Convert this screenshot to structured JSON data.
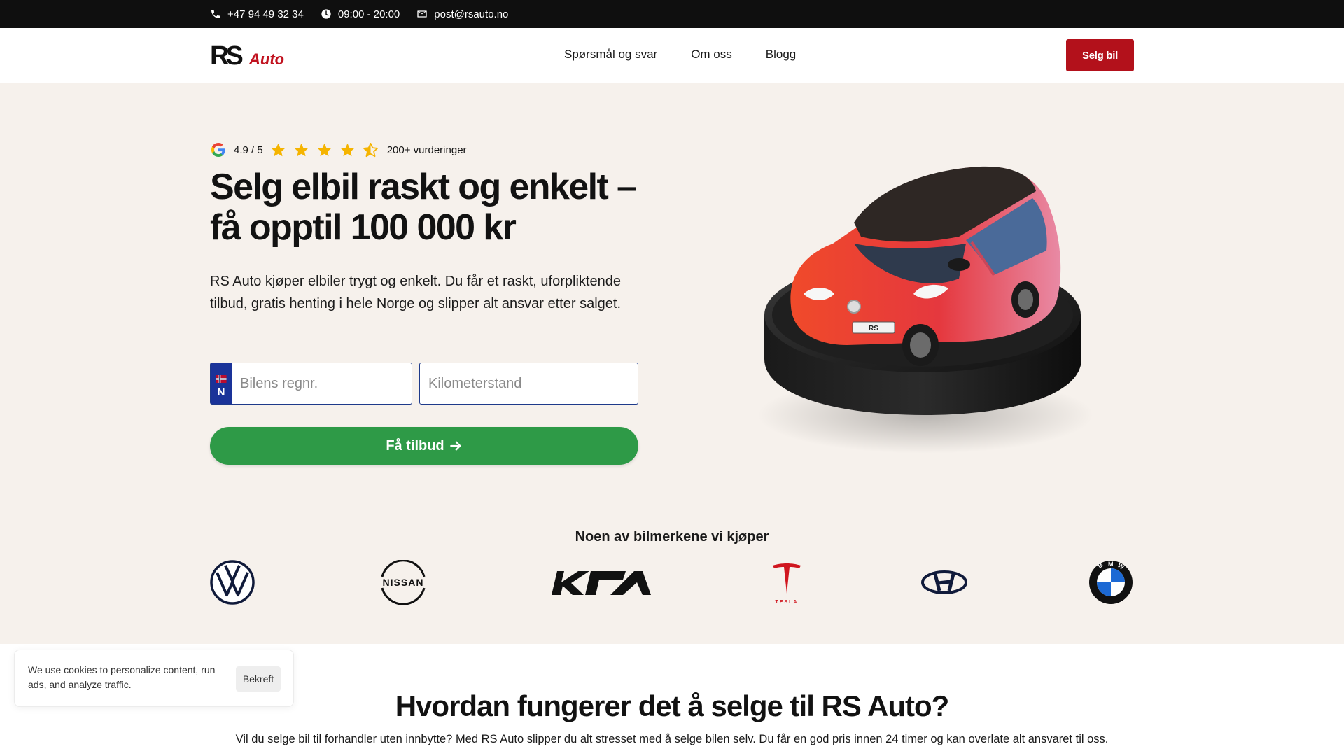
{
  "topbar": {
    "phone": "+47 94 49 32 34",
    "hours": "09:00 - 20:00",
    "email": "post@rsauto.no"
  },
  "header": {
    "logo_text": "RS Auto",
    "nav": [
      "Spørsmål og svar",
      "Om oss",
      "Blogg"
    ],
    "cta_label": "Selg bil"
  },
  "colors": {
    "brand_red": "#b3111b",
    "cta_green": "#2e9a47",
    "hero_bg": "#f6f1ec",
    "plate_blue": "#1a3399",
    "star": "#f5b400"
  },
  "hero": {
    "rating_score": "4.9 / 5",
    "rating_stars": 4.5,
    "rating_count": "200+ vurderinger",
    "headline": "Selg elbil raskt og enkelt – få opptil 100 000 kr",
    "lead": "RS Auto kjøper elbiler trygt og enkelt. Du får et raskt, uforpliktende tilbud, gratis henting i hele Norge og slipper alt ansvar etter salget.",
    "plate_letter": "N",
    "reg_placeholder": "Bilens regnr.",
    "km_placeholder": "Kilometerstand",
    "cta_label": "Få tilbud",
    "image_icon": "red-electric-car-on-pedestal"
  },
  "brands": {
    "title": "Noen av bilmerkene vi kjøper",
    "items": [
      "volkswagen-logo",
      "nissan-logo",
      "kia-logo",
      "tesla-logo",
      "hyundai-logo",
      "bmw-logo"
    ],
    "nissan_wordmark": "NISSAN",
    "tesla_wordmark": "TESLA",
    "bmw_letters": [
      "B",
      "M",
      "W"
    ]
  },
  "howto": {
    "title": "Hvordan fungerer det å selge til RS Auto?",
    "text": "Vil du selge bil til forhandler uten innbytte? Med RS Auto slipper du alt stresset med å selge bilen selv. Du får en god pris innen 24 timer og kan overlate alt ansvaret til oss."
  },
  "cookie": {
    "text": "We use cookies to personalize content, run ads, and analyze traffic.",
    "button": "Bekreft"
  }
}
